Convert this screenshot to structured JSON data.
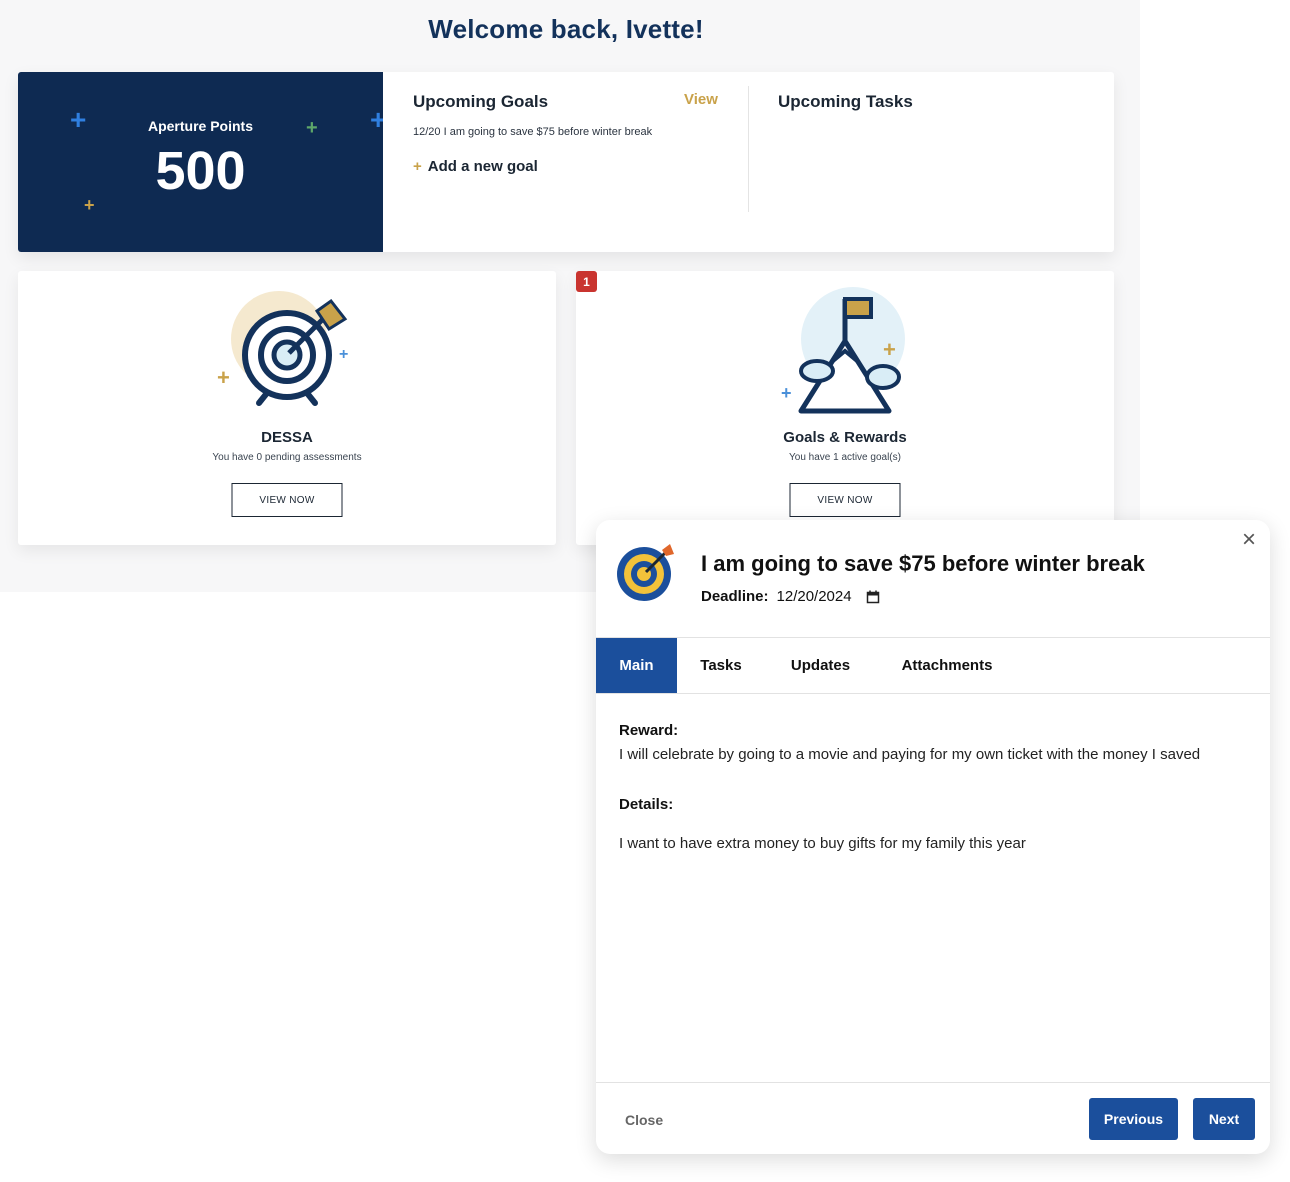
{
  "welcome": "Welcome back, Ivette!",
  "points": {
    "label": "Aperture Points",
    "value": "500"
  },
  "goals": {
    "title": "Upcoming Goals",
    "view_label": "View",
    "items": [
      "12/20 I am going to save $75 before winter break"
    ],
    "add_label": "Add a new goal"
  },
  "tasks": {
    "title": "Upcoming Tasks"
  },
  "tiles": [
    {
      "title": "DESSA",
      "subtitle": "You have 0 pending assessments",
      "button": "VIEW NOW"
    },
    {
      "title": "Goals & Rewards",
      "subtitle": "You have 1 active goal(s)",
      "button": "VIEW NOW",
      "badge": "1"
    }
  ],
  "modal": {
    "title": "I am going to save $75 before winter break",
    "deadline_label": "Deadline:",
    "deadline_value": "12/20/2024",
    "tabs": [
      "Main",
      "Tasks",
      "Updates",
      "Attachments"
    ],
    "active_tab": "Main",
    "reward_label": "Reward:",
    "reward_value": "I will celebrate by going to a movie and paying for my own ticket with the money I saved",
    "details_label": "Details:",
    "details_value": "I want to have extra money to buy gifts for my family this year",
    "close_label": "Close",
    "previous_label": "Previous",
    "next_label": "Next"
  },
  "colors": {
    "navy": "#0e2a52",
    "gold": "#c9a24a",
    "primary": "#1b4f9c",
    "badge": "#c9342f"
  },
  "icons": [
    "plus-icon",
    "target-icon",
    "mountain-flag-icon",
    "close-icon",
    "calendar-icon"
  ]
}
